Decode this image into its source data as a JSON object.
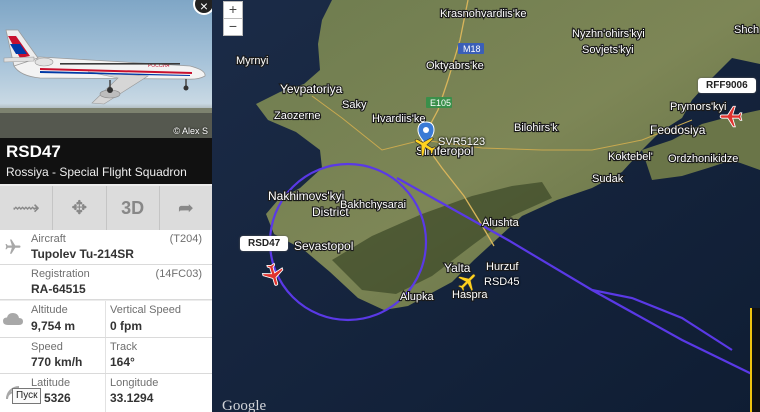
{
  "panel": {
    "photo_credit": "© Alex S",
    "close_symbol": "×",
    "callsign": "RSD47",
    "operator": "Rossiya - Special Flight Squadron",
    "toolbar": {
      "route_icon": "⟿",
      "fit_icon": "✥",
      "three_d": "3D",
      "share_icon": "➦"
    },
    "aircraft": {
      "label": "Aircraft",
      "code": "(T204)",
      "value": "Tupolev Tu-214SR"
    },
    "registration": {
      "label": "Registration",
      "code": "(14FC03)",
      "value": "RA-64515"
    },
    "altitude": {
      "label": "Altitude",
      "value": "9,754 m"
    },
    "vertical_speed": {
      "label": "Vertical Speed",
      "value": "0 fpm"
    },
    "speed": {
      "label": "Speed",
      "value": "770 km/h"
    },
    "track": {
      "label": "Track",
      "value": "164°"
    },
    "latitude": {
      "label": "Latitude",
      "value": "5326"
    },
    "longitude": {
      "label": "Longitude",
      "value": "33.1294"
    },
    "tooltip": "Пуск",
    "livery_text": "РОССИЯ"
  },
  "map": {
    "zoom_in": "+",
    "zoom_out": "−",
    "places": {
      "mirnyi": "Myrnyi",
      "krasnohvardiiske": "Krasnohvardiis'ke",
      "nyzhnohirskyi": "Nyzhn'ohirs'kyi",
      "sovjetskyi": "Sovjets'kyi",
      "m18": "M18",
      "oktyabrske": "Oktyabrs'ke",
      "yevpatoriya": "Yevpatoriya",
      "saky": "Saky",
      "e105": "E105",
      "zaozerne": "Zaozerne",
      "hvardiiske": "Hvardiis'ke",
      "bilohirsk": "Bilohirs'k",
      "feodosiya": "Feodosiya",
      "prymorskyi": "Prymors'kyi",
      "simferopol": "Simferopol",
      "koktebel": "Koktebel'",
      "ordzhonikidze": "Ordzhonikidze",
      "sudak": "Sudak",
      "nakhimovskyi": "Nakhimovs'kyi",
      "district": "District",
      "bakhchysarai": "Bakhchysarai",
      "sevastopol": "Sevastopol",
      "alushta": "Alushta",
      "yalta": "Yalta",
      "hurzuf": "Hurzuf",
      "alupka": "Alupka",
      "haspra": "Haspra",
      "google": "Google",
      "shchelkino": "Shch"
    },
    "flights": {
      "selected": "RSD47",
      "rff": "RFF9006",
      "rsd45": "RSD45",
      "svr": "SVR5123"
    },
    "colors": {
      "trail": "#5a39e6",
      "plane_selected": "#e0332f",
      "plane_other": "#ffd21f"
    }
  }
}
